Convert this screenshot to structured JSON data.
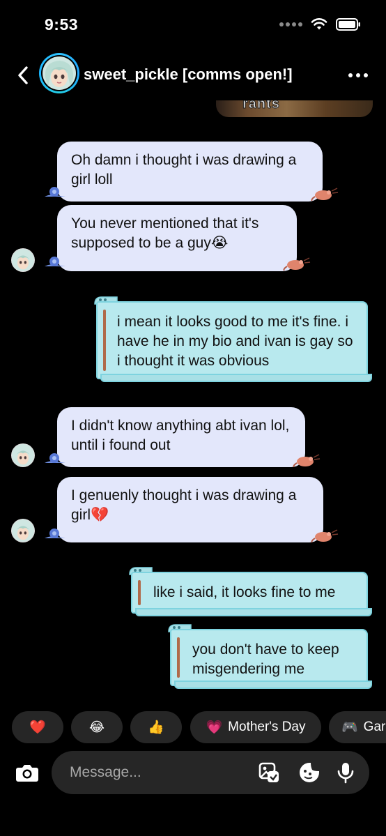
{
  "status": {
    "time": "9:53"
  },
  "header": {
    "name": "sweet_pickle [comms open!]"
  },
  "shared_image": {
    "caption": "rants"
  },
  "messages": [
    {
      "side": "in",
      "text": "Oh damn i thought i was drawing a girl loll"
    },
    {
      "side": "in",
      "text": "You never mentioned that it's supposed to be a guy😭"
    },
    {
      "side": "out",
      "text": "i mean it looks good to me it's fine. i have he in my bio and ivan is gay so i thought it was obvious"
    },
    {
      "side": "in",
      "text": "I didn't know anything abt ivan lol, until i found out"
    },
    {
      "side": "in",
      "text": "I genuenly thought i was drawing a girl💔"
    },
    {
      "side": "out",
      "text": "like i said, it looks fine to me"
    },
    {
      "side": "out",
      "text": "you don't have to keep misgendering me"
    }
  ],
  "quick_replies": [
    {
      "label": "❤️"
    },
    {
      "label": "😂"
    },
    {
      "label": "👍"
    },
    {
      "emoji": "💗",
      "label": "Mother's Day"
    },
    {
      "emoji": "🎮",
      "label": "Gar"
    }
  ],
  "composer": {
    "placeholder": "Message..."
  },
  "colors": {
    "incoming_bubble": "#e3e7fb",
    "outgoing_bubble": "#b8e9ee",
    "background": "#000000"
  }
}
